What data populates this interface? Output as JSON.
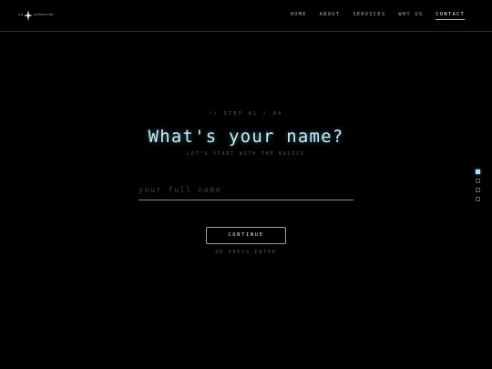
{
  "brand": {
    "left_text": "in",
    "right_text": "ochevron"
  },
  "nav": {
    "items": [
      {
        "label": "HOME"
      },
      {
        "label": "ABOUT"
      },
      {
        "label": "SERVICES"
      },
      {
        "label": "WHY US"
      },
      {
        "label": "CONTACT",
        "active": true
      }
    ]
  },
  "form": {
    "step": "// STEP 01 / 04",
    "title": "What's your name?",
    "subtitle": "LET'S START WITH THE BASICS",
    "input_value": "",
    "input_placeholder": "your full name",
    "continue_label": "CONTINUE",
    "hint": "OR PRESS ENTER"
  },
  "progress": {
    "current_step": 1,
    "total_steps": 4
  },
  "colors": {
    "background": "#000000",
    "accent": "#a9e6f5",
    "heading": "#c7eef9",
    "muted": "#4a6068"
  },
  "icons": {
    "logo": "sparkle-star-icon"
  }
}
